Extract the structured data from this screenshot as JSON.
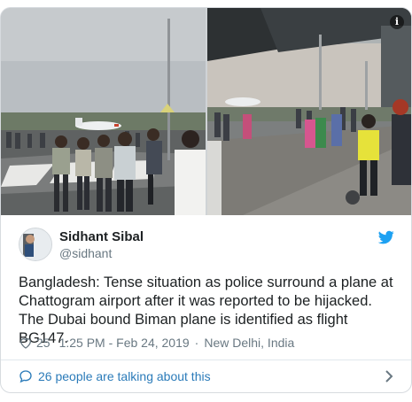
{
  "tweet": {
    "author_name": "Sidhant Sibal",
    "author_handle": "@sidhant",
    "text": "Bangladesh: Tense situation as police surround a plane at Chattogram airport after it was reported to be hijacked. The Dubai bound Biman plane is identified as flight BG147.",
    "like_count": "25",
    "timestamp": "1:25 PM - Feb 24, 2019",
    "separator": "·",
    "location": "New Delhi, India",
    "conversation_label": "26 people are talking about this"
  },
  "icons": {
    "info": "info-icon",
    "brand": "twitter-bird-icon",
    "like": "heart-icon",
    "conversation": "speech-bubble-icon",
    "open": "chevron-right-icon"
  },
  "colors": {
    "brand_blue": "#1da1f2",
    "link_blue": "#2b7bb9",
    "muted_text": "#697882",
    "body_text": "#1c2022"
  }
}
